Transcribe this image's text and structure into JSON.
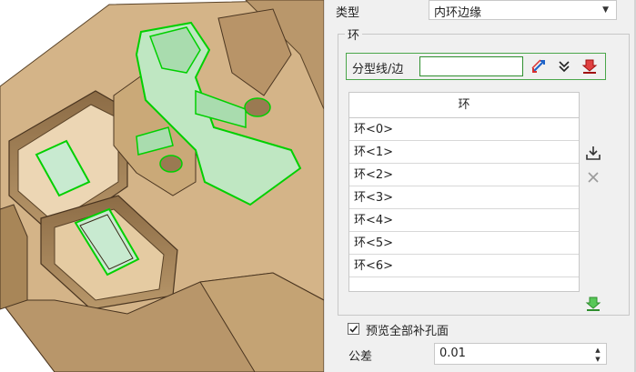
{
  "type_row": {
    "label": "类型",
    "value": "内环边缘"
  },
  "loop_group": {
    "title": "环",
    "pick_label": "分型线/边",
    "pick_value": "",
    "icons": [
      "flip-arrows-icon",
      "double-chevron-down-icon",
      "red-filter-icon"
    ]
  },
  "loop_table": {
    "header": "环",
    "rows": [
      "环<0>",
      "环<1>",
      "环<2>",
      "环<3>",
      "环<4>",
      "环<5>",
      "环<6>"
    ],
    "side_icons": [
      "import-icon",
      "delete-icon",
      "green-apply-icon"
    ]
  },
  "preview": {
    "label": "预览全部补孔面",
    "checked": true
  },
  "tolerance": {
    "label": "公差",
    "value": "0.01"
  },
  "colors": {
    "model": "#d9b98c",
    "model_dark": "#a5845a",
    "highlight": "#00e000",
    "fill": "#bfe7c2"
  }
}
